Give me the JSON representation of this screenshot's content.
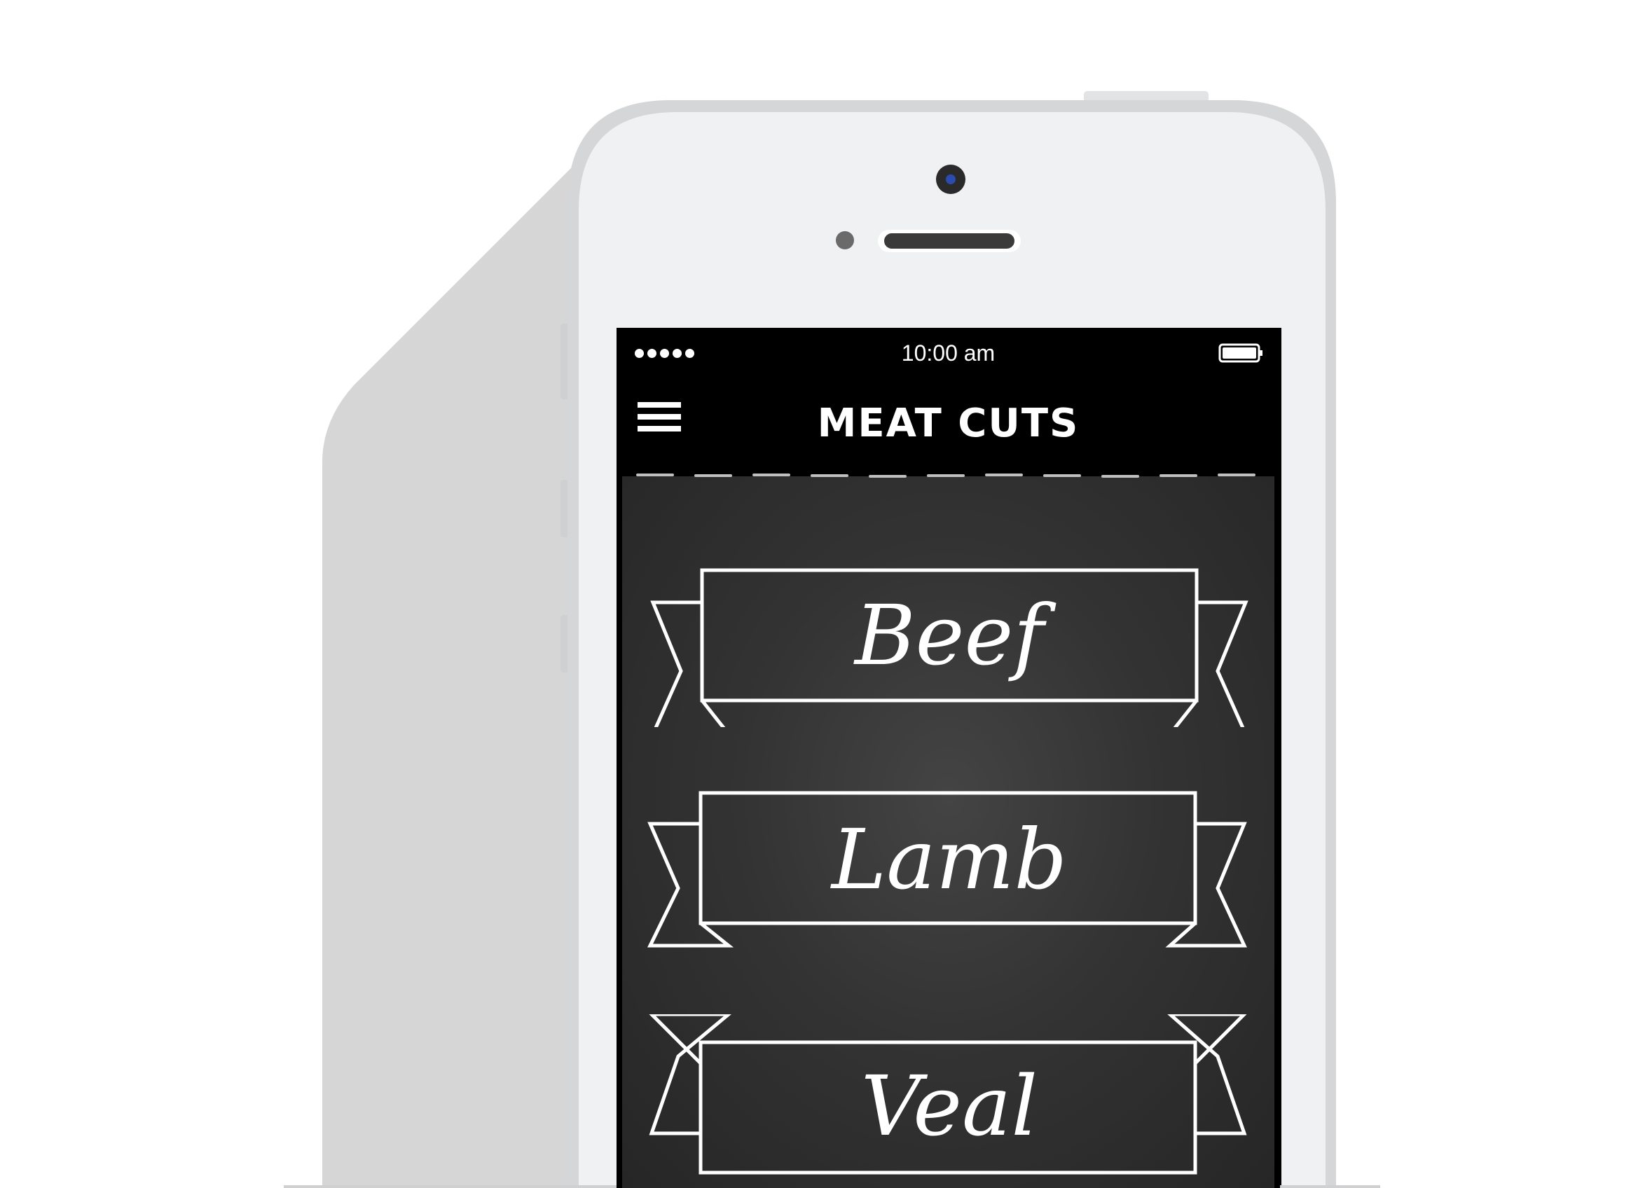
{
  "status_bar": {
    "time": "10:00 am"
  },
  "nav_bar": {
    "title": "MEAT CUTS"
  },
  "banners": [
    {
      "label": "Beef"
    },
    {
      "label": "Lamb"
    },
    {
      "label": "Veal"
    }
  ],
  "colors": {
    "background": "#ffffff",
    "shadow": "#d6d6d6",
    "phone_body": "#f0f1f2",
    "screen": "#000000",
    "chalkboard": "#333333",
    "chalk": "#ffffff"
  }
}
